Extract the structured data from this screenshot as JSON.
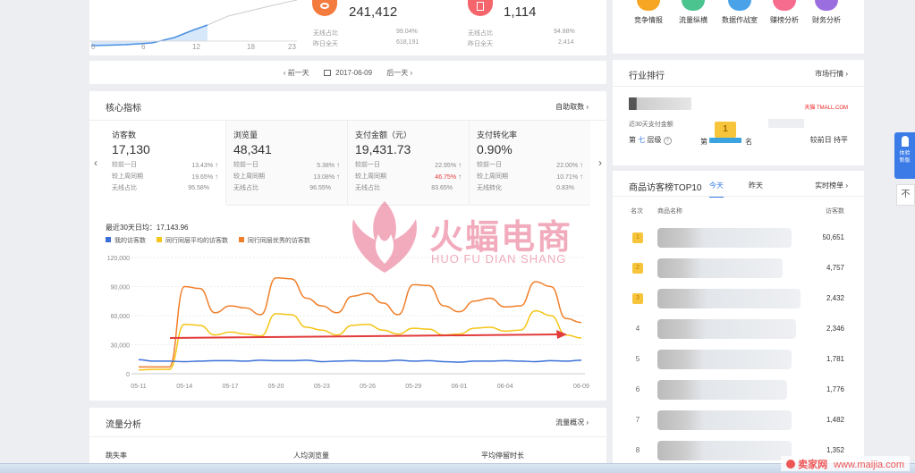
{
  "top_left": {
    "x_ticks": [
      "0",
      "6",
      "12",
      "18",
      "23"
    ],
    "metric1": {
      "value": "241,412",
      "r1_label": "无线占比",
      "r1_value": "99.04%",
      "r2_label": "昨日全天",
      "r2_value": "618,191"
    },
    "metric2": {
      "value": "1,114",
      "r1_label": "无线占比",
      "r1_value": "94.88%",
      "r2_label": "昨日全天",
      "r2_value": "2,414"
    }
  },
  "tools": [
    "竞争情报",
    "流量纵横",
    "数据作战室",
    "赚榜分析",
    "财务分析"
  ],
  "date_nav": {
    "prev": "前一天",
    "date": "2017-06-09",
    "next": "后一天"
  },
  "core": {
    "title": "核心指标",
    "action": "自助取数",
    "metrics": [
      {
        "name": "访客数",
        "value": "17,130",
        "rows": [
          [
            "较前一日",
            "13.43%"
          ],
          [
            "较上周同期",
            "19.65%"
          ],
          [
            "无线占比",
            "95.58%"
          ]
        ]
      },
      {
        "name": "浏览量",
        "value": "48,341",
        "rows": [
          [
            "较前一日",
            "5.38%"
          ],
          [
            "较上周同期",
            "13.08%"
          ],
          [
            "无线占比",
            "96.55%"
          ]
        ]
      },
      {
        "name": "支付金额（元）",
        "value": "19,431.73",
        "rows": [
          [
            "较前一日",
            "22.95%"
          ],
          [
            "较上周同期",
            "46.75%"
          ],
          [
            "无线占比",
            "83.65%"
          ]
        ]
      },
      {
        "name": "支付转化率",
        "value": "0.90%",
        "rows": [
          [
            "较前一日",
            "22.00%"
          ],
          [
            "较上周同期",
            "10.71%"
          ],
          [
            "无线转化",
            "0.83%"
          ]
        ]
      }
    ],
    "avg_label": "最近30天日均：17,143.96",
    "legend": [
      "我的访客数",
      "同行同层平均的访客数",
      "同行同层优秀的访客数"
    ]
  },
  "watermark": {
    "cn": "火蝠电商",
    "en": "HUO FU DIAN SHANG"
  },
  "chart_data": {
    "type": "line",
    "x": [
      "05-11",
      "05-12",
      "05-13",
      "05-14",
      "05-15",
      "05-16",
      "05-17",
      "05-18",
      "05-19",
      "05-20",
      "05-21",
      "05-22",
      "05-23",
      "05-24",
      "05-25",
      "05-26",
      "05-27",
      "05-28",
      "05-29",
      "05-30",
      "05-31",
      "06-01",
      "06-02",
      "06-03",
      "06-04",
      "06-05",
      "06-06",
      "06-07",
      "06-08",
      "06-09"
    ],
    "xticks": [
      "05-11",
      "05-14",
      "05-17",
      "05-20",
      "05-23",
      "05-26",
      "05-29",
      "06-01",
      "06-04",
      "06-09"
    ],
    "ylim": [
      0,
      120000
    ],
    "yticks": [
      "0",
      "30,000",
      "60,000",
      "90,000",
      "120,000"
    ],
    "colors": [
      "#3a6fd8",
      "#f5c518",
      "#f07f2a"
    ],
    "series": [
      {
        "name": "我的访客数",
        "values": [
          14500,
          13000,
          13000,
          12500,
          13000,
          13500,
          13500,
          13000,
          14000,
          13500,
          13500,
          14000,
          12500,
          13000,
          13500,
          13000,
          13000,
          14000,
          13000,
          13500,
          12500,
          12000,
          13000,
          13000,
          13500,
          13000,
          12500,
          13500,
          13000,
          14000
        ]
      },
      {
        "name": "同行同层平均的访客数",
        "values": [
          4000,
          4500,
          4500,
          51000,
          50000,
          40000,
          43000,
          41000,
          39000,
          62000,
          61000,
          48000,
          45000,
          40000,
          50000,
          51000,
          45000,
          41000,
          47000,
          46000,
          40000,
          41000,
          47000,
          48000,
          44000,
          45000,
          65000,
          60000,
          40000,
          37000
        ]
      },
      {
        "name": "同行同层优秀的访客数",
        "values": [
          7000,
          7000,
          7000,
          90000,
          88000,
          63000,
          70000,
          68000,
          61000,
          99000,
          98000,
          78000,
          70000,
          63000,
          80000,
          83000,
          73000,
          61000,
          92000,
          91000,
          70000,
          64000,
          75000,
          78000,
          69000,
          70000,
          95000,
          90000,
          57000,
          53000
        ]
      }
    ]
  },
  "traffic": {
    "title": "流量分析",
    "action": "流量概况",
    "cols": [
      "跳失率",
      "人均浏览量",
      "平均停留时长"
    ]
  },
  "industry": {
    "title": "行业排行",
    "action": "市场行情",
    "brand": "天猫 TMALL.COM",
    "sub_label": "近30天支付金额",
    "level_prefix": "第",
    "level_num": "七",
    "level_suffix": "层级",
    "rank_pre": "第",
    "rank_num": "1",
    "rank_post": "名",
    "compare": "较前日 持平"
  },
  "top10": {
    "title": "商品访客榜TOP10",
    "tabs": [
      "今天",
      "昨天"
    ],
    "action": "实时榜单",
    "headers": [
      "名次",
      "商品名称",
      "访客数"
    ],
    "rows": [
      {
        "rank": "1",
        "value": "50,651"
      },
      {
        "rank": "2",
        "value": "4,757"
      },
      {
        "rank": "3",
        "value": "2,432"
      },
      {
        "rank": "4",
        "value": "2,346"
      },
      {
        "rank": "5",
        "value": "1,781"
      },
      {
        "rank": "6",
        "value": "1,776"
      },
      {
        "rank": "7",
        "value": "1,482"
      },
      {
        "rank": "8",
        "value": "1,352"
      }
    ]
  },
  "side": {
    "experience": "体验新版",
    "top": "不"
  },
  "footer": {
    "site": "卖家网",
    "url": "www.maijia.com"
  }
}
